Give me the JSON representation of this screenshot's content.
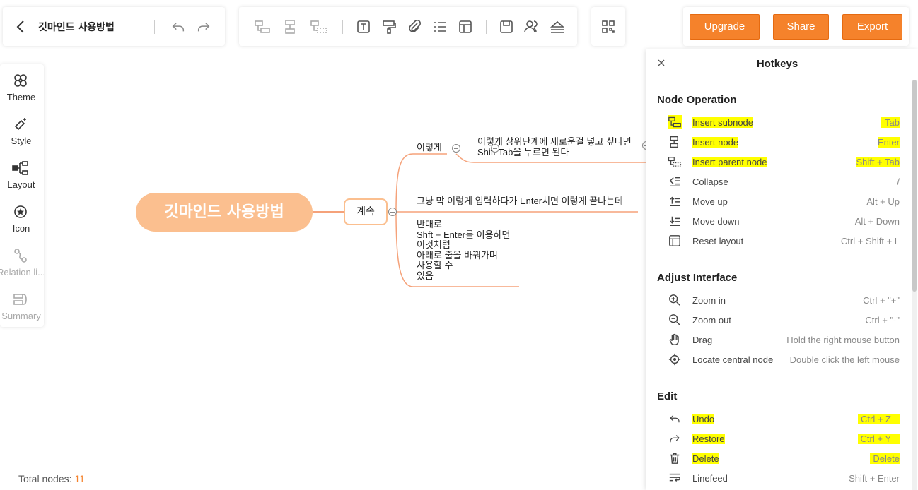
{
  "toolbar": {
    "title": "깃마인드 사용방법",
    "upgrade_label": "Upgrade",
    "share_label": "Share",
    "export_label": "Export",
    "accent_color": "#f5822b"
  },
  "sidebar": {
    "items": [
      {
        "label": "Theme",
        "icon": "theme-icon"
      },
      {
        "label": "Style",
        "icon": "style-icon"
      },
      {
        "label": "Layout",
        "icon": "layout-icon"
      },
      {
        "label": "Icon",
        "icon": "star-icon"
      },
      {
        "label": "Relation li...",
        "icon": "relation-icon"
      },
      {
        "label": "Summary",
        "icon": "summary-icon"
      }
    ]
  },
  "mindmap": {
    "root": "깃마인드 사용방법",
    "sub": "계속",
    "branch1": "이렇게",
    "branch1_child": [
      "이렇게 상위단계에 새로운걸 넣고 싶다면",
      "Shift Tab을 누르면 된다"
    ],
    "branch2": "그냥 막 이렇게 입력하다가 Enter치면 이렇게 끝나는데",
    "branch3": [
      "반대로",
      "Shft + Enter를 이용하면",
      "이것처럼",
      "아래로 줄을 바꿔가며",
      "사용할 수",
      "있음"
    ]
  },
  "footer": {
    "total_label": "Total nodes:",
    "total_value": "11"
  },
  "hotkeys": {
    "title": "Hotkeys",
    "sections": [
      {
        "title": "Node Operation",
        "rows": [
          {
            "label": "Insert subnode",
            "key": "Tab"
          },
          {
            "label": "Insert node",
            "key": "Enter"
          },
          {
            "label": "Insert parent node",
            "key": "Shift + Tab"
          },
          {
            "label": "Collapse",
            "key": "/"
          },
          {
            "label": "Move up",
            "key": "Alt + Up"
          },
          {
            "label": "Move down",
            "key": "Alt + Down"
          },
          {
            "label": "Reset layout",
            "key": "Ctrl + Shift + L"
          }
        ]
      },
      {
        "title": "Adjust Interface",
        "rows": [
          {
            "label": "Zoom in",
            "key": "Ctrl + \"+\""
          },
          {
            "label": "Zoom out",
            "key": "Ctrl + \"-\""
          },
          {
            "label": "Drag",
            "key": "Hold the right mouse button"
          },
          {
            "label": "Locate central node",
            "key": "Double click the left mouse"
          }
        ]
      },
      {
        "title": "Edit",
        "rows": [
          {
            "label": "Undo",
            "key": "Ctrl + Z"
          },
          {
            "label": "Restore",
            "key": "Ctrl + Y"
          },
          {
            "label": "Delete",
            "key": "Delete"
          },
          {
            "label": "Linefeed",
            "key": "Shift + Enter"
          }
        ]
      }
    ]
  }
}
